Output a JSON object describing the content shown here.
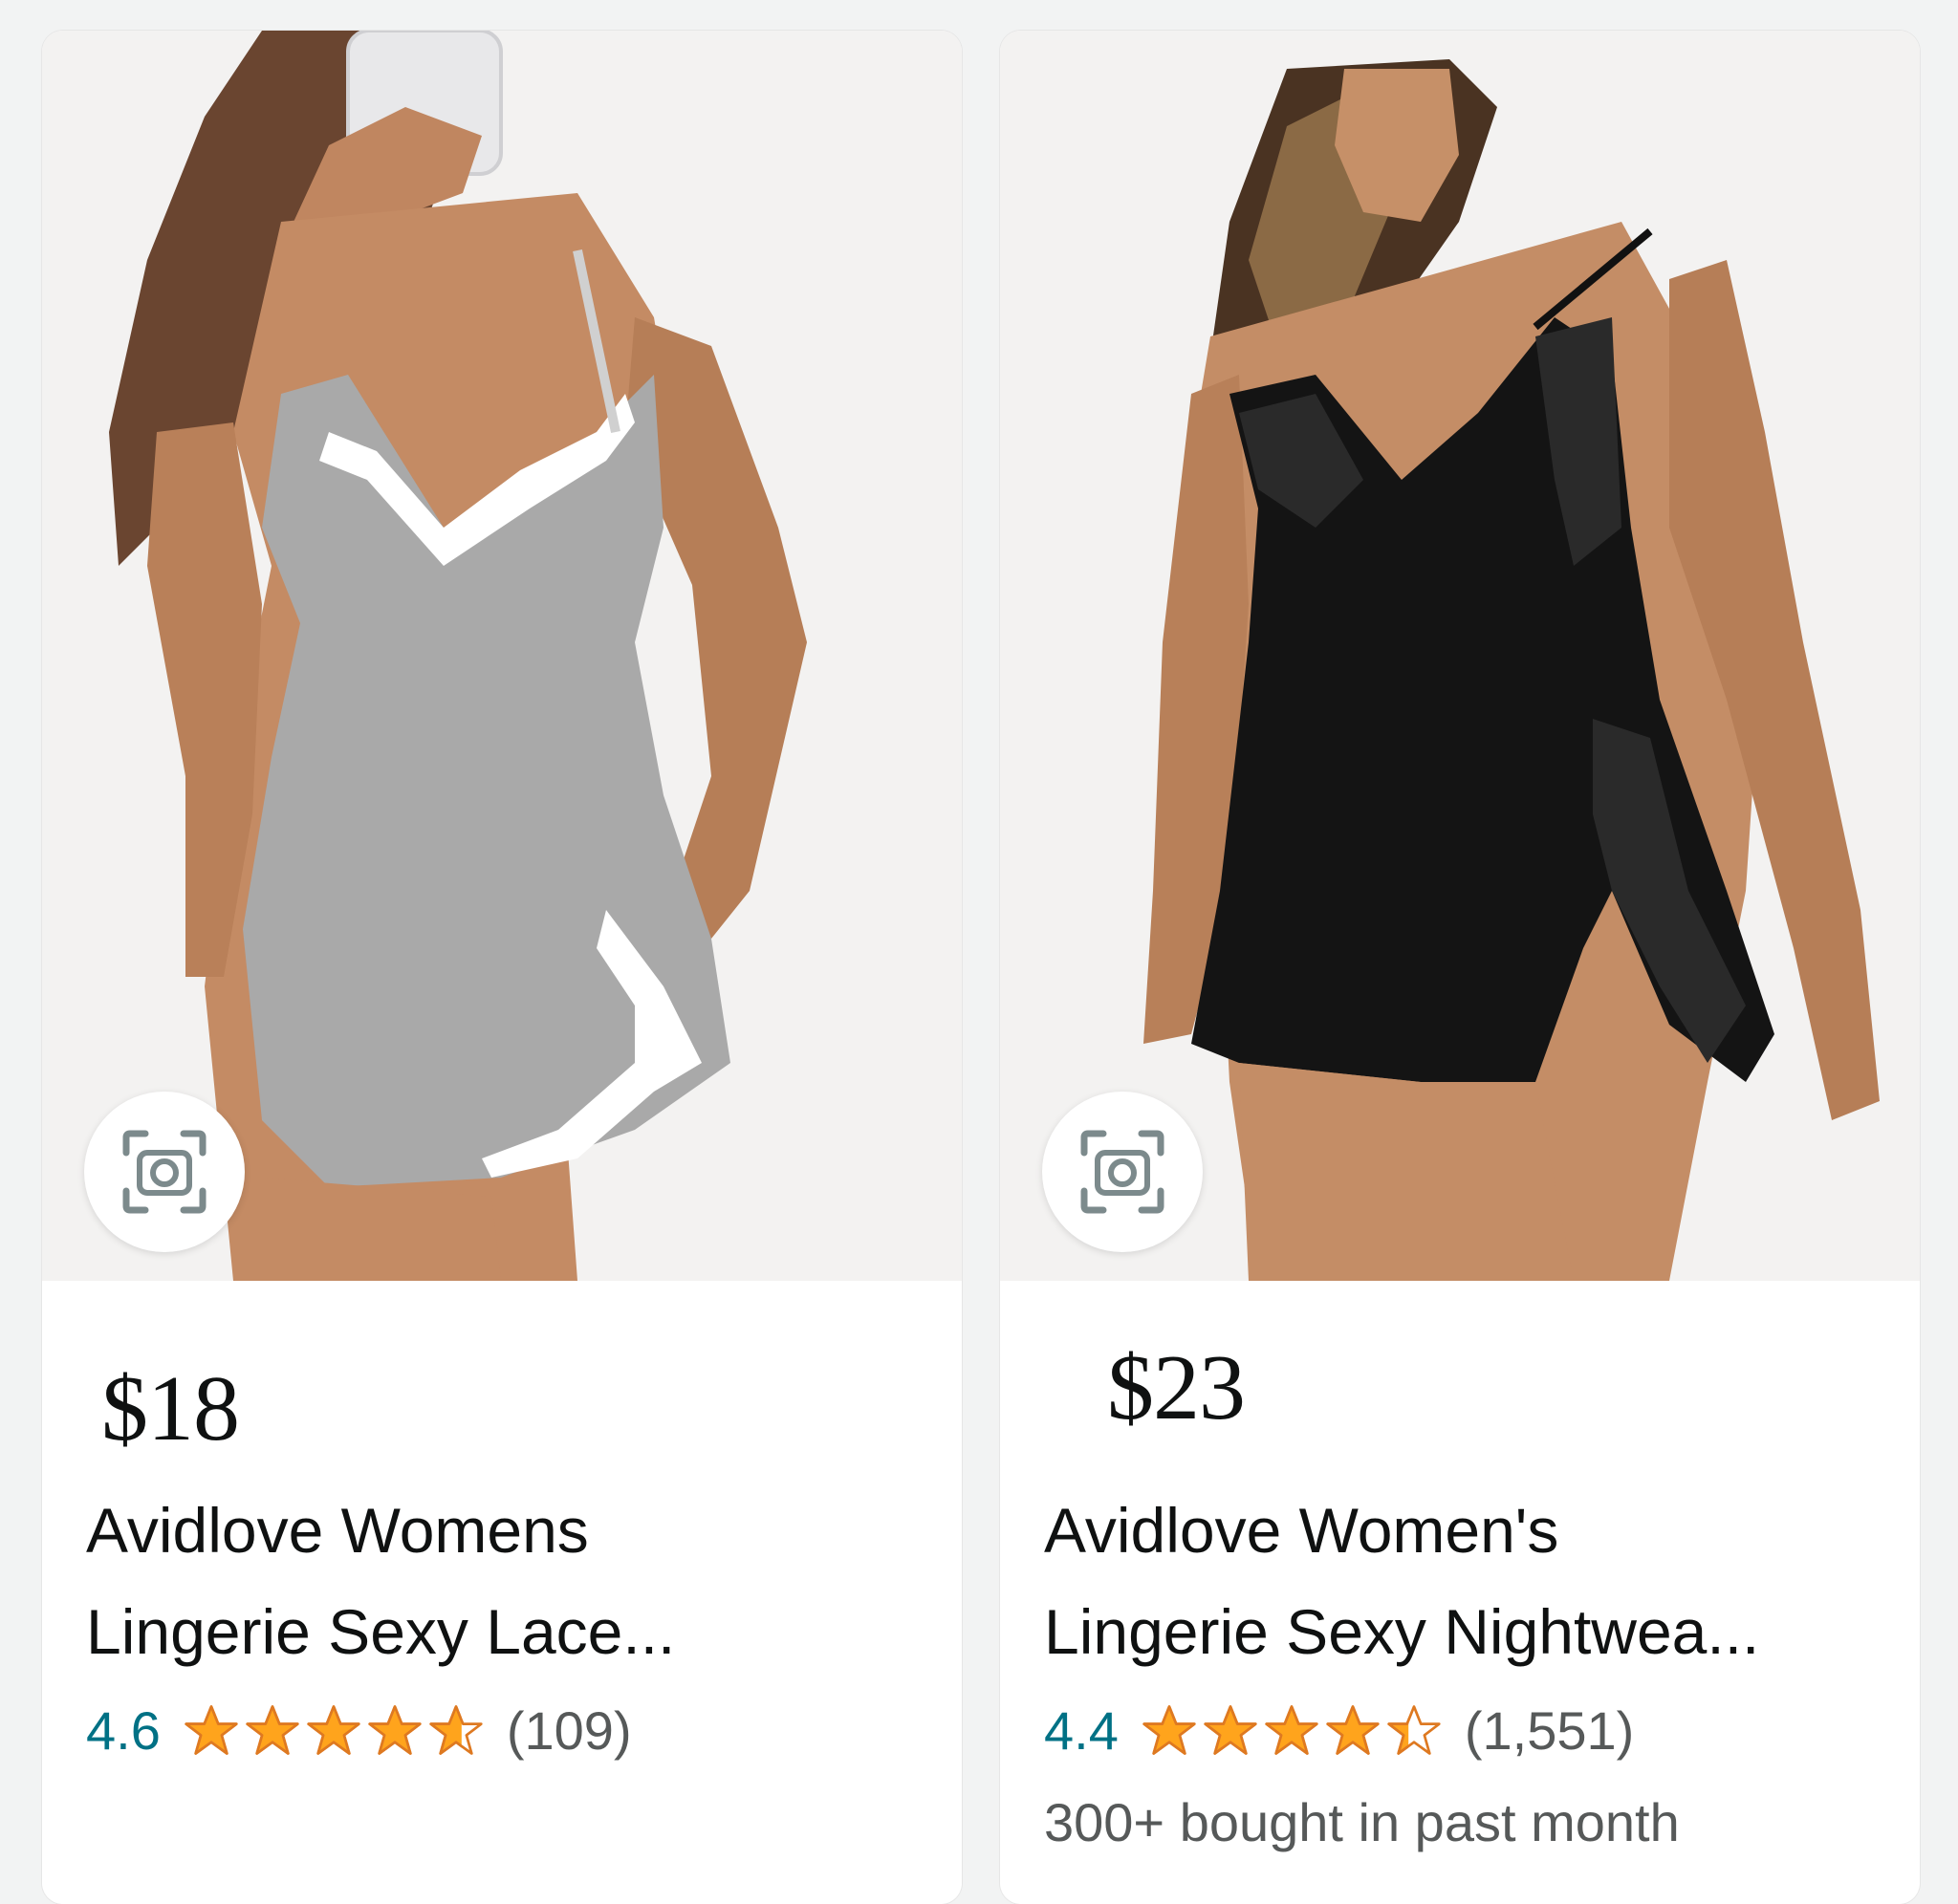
{
  "products": [
    {
      "price": "$18",
      "title_line1": "Avidlove Womens",
      "title_line2": "Lingerie Sexy Lace...",
      "rating": "4.6",
      "rating_value": 4.6,
      "review_count": "(109)",
      "image_alt": "grey lace nightgown product photo",
      "dress_color": "#a9a9a9",
      "trim_color": "#ffffff"
    },
    {
      "price": "$23",
      "title_line1": "Avidlove Women's",
      "title_line2": "Lingerie Sexy Nightwea...",
      "rating": "4.4",
      "rating_value": 4.4,
      "review_count": "(1,551)",
      "bought_text": "300+ bought in past month",
      "image_alt": "black lace babydoll product photo",
      "dress_color": "#141414",
      "trim_color": "#2a2a2a"
    }
  ],
  "colors": {
    "star": "#ffa41c",
    "star_stroke": "#de7921",
    "rating_link": "#007185",
    "text_primary": "#0f1111",
    "text_secondary": "#565959"
  },
  "icons": {
    "lens": "camera-search-icon",
    "star": "star-icon"
  }
}
